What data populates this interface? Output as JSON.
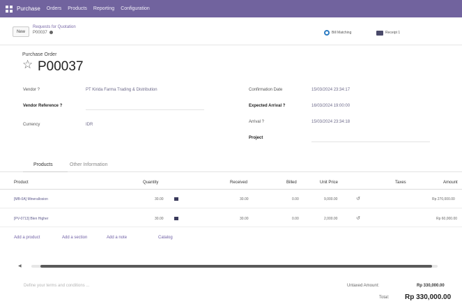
{
  "nav": {
    "items": [
      "Purchase",
      "Orders",
      "Products",
      "Reporting",
      "Configuration"
    ]
  },
  "control": {
    "new_label": "New",
    "breadcrumb_parent": "Requests for Quotation",
    "breadcrumb_current": "P00037",
    "smart_buttons": [
      {
        "icon": "globe-icon",
        "label": "Bill Matching"
      },
      {
        "icon": "truck-icon",
        "label": "Receipt 1"
      }
    ]
  },
  "sheet": {
    "label": "Purchase Order",
    "title": "P00037",
    "left_fields": [
      {
        "label": "Vendor ?",
        "value": "PT Kirida Farma Trading & Distribution",
        "bold": false
      },
      {
        "label": "Vendor Reference ?",
        "value": "",
        "bold": true
      },
      {
        "label": "Currency",
        "value": "IDR",
        "bold": false
      }
    ],
    "right_fields": [
      {
        "label": "Confirmation Date",
        "value": "15/03/2024 23:34:17",
        "bold": false
      },
      {
        "label": "Expected Arrival ?",
        "value": "16/03/2024 19:00:00",
        "bold": true
      },
      {
        "label": "Arrival ?",
        "value": "15/03/2024 23:34:18",
        "bold": false
      },
      {
        "label": "Project",
        "value": "",
        "bold": true
      }
    ]
  },
  "tabs": [
    "Products",
    "Other Information"
  ],
  "table": {
    "headers": [
      "Product",
      "Quantity",
      "Received",
      "Billed",
      "Unit Price",
      "Taxes",
      "Amount"
    ],
    "rows": [
      {
        "product": "[MB-0A] Minerallosion",
        "quantity": "30.00",
        "received": "30.00",
        "billed": "0.00",
        "unit_price": "9,000.00",
        "amount": "Rp 270,000.00"
      },
      {
        "product": "[PV-0713] Blen Higher",
        "quantity": "30.00",
        "received": "30.00",
        "billed": "0.00",
        "unit_price": "2,000.00",
        "amount": "Rp 60,000.00"
      }
    ],
    "add_links": [
      "Add a product",
      "Add a section",
      "Add a note",
      "Catalog"
    ]
  },
  "footer": {
    "terms_placeholder": "Define your terms and conditions ...",
    "untaxed_label": "Untaxed Amount:",
    "untaxed_value": "Rp 330,000.00",
    "total_label": "Total:",
    "total_value": "Rp 330,000.00"
  },
  "colors": {
    "brand": "#71639e",
    "link": "#6f5fa5"
  }
}
